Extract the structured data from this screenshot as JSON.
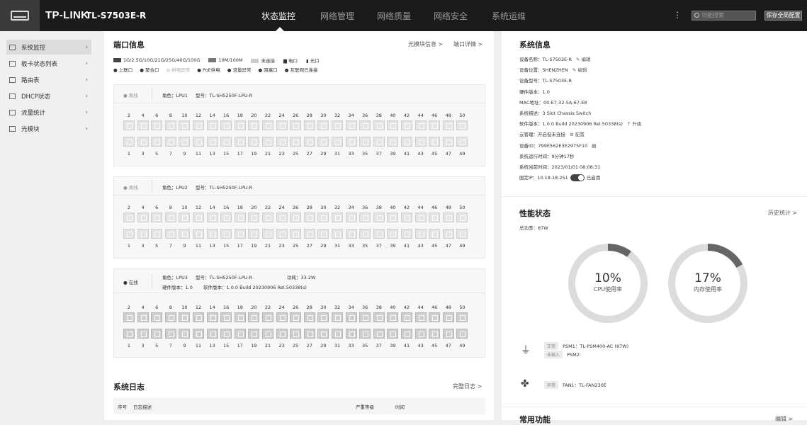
{
  "brand": "TP-LINK",
  "model": "TL-S7503E-R",
  "nav": [
    "状态监控",
    "网络管理",
    "网络质量",
    "网络安全",
    "系统运维"
  ],
  "search_placeholder": "功能搜索",
  "save_label": "保存全局配置",
  "sidebar": [
    {
      "label": "系统监控",
      "icon": "monitor-icon"
    },
    {
      "label": "板卡状态列表",
      "icon": "list-icon"
    },
    {
      "label": "路由表",
      "icon": "route-icon"
    },
    {
      "label": "DHCP状态",
      "icon": "dhcp-icon"
    },
    {
      "label": "流量统计",
      "icon": "traffic-icon"
    },
    {
      "label": "光模块",
      "icon": "module-icon"
    }
  ],
  "ports": {
    "title": "端口信息",
    "link1": "光模块信息 >",
    "link2": "端口详情 >",
    "legend1": [
      "1G/2.5G/10G/21G/25G/40G/100G",
      "10M/100M",
      "未连接",
      "电口",
      "光口"
    ],
    "legend2": [
      "上联口",
      "聚合口",
      "供电异常",
      "PoE供电",
      "流量异常",
      "阻塞口",
      "互联网已连接"
    ],
    "top_nums": [
      "2",
      "4",
      "6",
      "8",
      "10",
      "12",
      "14",
      "16",
      "18",
      "20",
      "22",
      "24",
      "26",
      "28",
      "30",
      "32",
      "34",
      "36",
      "38",
      "40",
      "42",
      "44",
      "46",
      "48",
      "50"
    ],
    "bottom_nums": [
      "1",
      "3",
      "5",
      "7",
      "9",
      "11",
      "13",
      "15",
      "17",
      "19",
      "21",
      "23",
      "25",
      "27",
      "29",
      "31",
      "33",
      "35",
      "37",
      "39",
      "41",
      "43",
      "45",
      "47",
      "49"
    ],
    "cards": [
      {
        "status": "● 离线",
        "role": "角色：LPU1",
        "type": "型号：TL-SH5250F-LPU-R",
        "online": false
      },
      {
        "status": "● 离线",
        "role": "角色：LPU2",
        "type": "型号：TL-SH5250F-LPU-R",
        "online": false
      },
      {
        "status": "● 在线",
        "role": "角色：LPU3",
        "type": "型号：TL-SH5250F-LPU-R",
        "power": "功耗：33.2W",
        "hw": "硬件版本：1.0",
        "sw": "软件版本：1.0.0 Build 20230906 Rel.50338(s)",
        "online": true
      }
    ]
  },
  "log": {
    "title": "系统日志",
    "link": "完整日志 >",
    "cols": [
      "序号",
      "日志描述",
      "严重等级",
      "时间"
    ]
  },
  "sysinfo": {
    "title": "系统信息",
    "rows": [
      "设备名称：TL-S7503E-R",
      "设备位置：SHENZHEN",
      "设备型号：TL-S7503E-R",
      "硬件版本：1.0",
      "MAC地址：00-E7-32-5A-67-E8",
      "系统描述：3 Slot Chassis Switch",
      "软件版本：1.0.0 Build 20230906 Rel.50338(s)",
      "云管理：开启但未连接",
      "设备ID：799E562E3E2975F10",
      "系统运行时间：9分钟17秒",
      "系统当前时间：2023/01/01 08:08:31",
      "固定IP：10.18.18.251"
    ],
    "edit": "编辑",
    "upgrade": "升级",
    "config": "配置",
    "enabled": "已启用"
  },
  "perf": {
    "title": "性能状态",
    "link": "历史统计 >",
    "power": "总功率：87W",
    "cpu": {
      "value": "10%",
      "label": "CPU使用率",
      "fraction": 0.1
    },
    "mem": {
      "value": "17%",
      "label": "内存使用率",
      "fraction": 0.17
    },
    "psu": [
      {
        "tag": "正常",
        "name": "PSM1：TL-PSM400-AC (87W)"
      },
      {
        "tag": "未插入",
        "name": "PSM2:"
      }
    ],
    "fan": {
      "tag": "异常",
      "name": "FAN1：TL-FAN230E"
    }
  },
  "common": {
    "title": "常用功能",
    "link": "编辑 >"
  },
  "colors": {
    "topbar": "#1b1b1b",
    "donut_track": "#dcdcdc",
    "donut_fill": "#666666",
    "toggle": "#444444"
  }
}
